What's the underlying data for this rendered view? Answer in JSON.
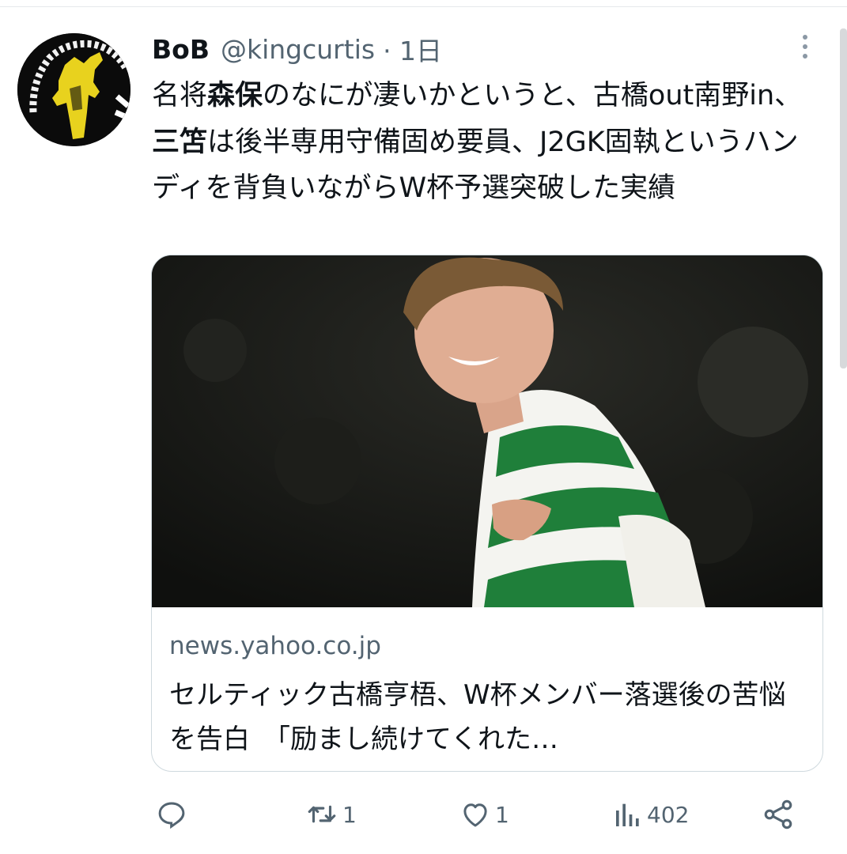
{
  "tweet": {
    "author_name": "BoB",
    "handle": "@kingcurtis",
    "time": "· 1日",
    "text_parts": [
      "名将",
      "森保",
      "のなにが凄いかというと、古橋out南野in、",
      "三笘",
      "は後半専用守備固め要員、J2GK固執というハンディを背負いながらW杯予選突破した実績"
    ],
    "avatar_icon": "band-album-avatar-icon",
    "more_icon": "more-options-icon"
  },
  "link_card": {
    "domain": "news.yahoo.co.jp",
    "title": "セルティック古橋亨梧、W杯メンバー落選後の苦悩を告白　「励まし続けてくれた…",
    "image": "celtic-player-photo"
  },
  "actions": {
    "reply": {
      "icon": "reply-icon",
      "count": ""
    },
    "retweet": {
      "icon": "retweet-icon",
      "count": "1"
    },
    "like": {
      "icon": "heart-icon",
      "count": "1"
    },
    "views": {
      "icon": "views-chart-icon",
      "count": "402"
    },
    "share": {
      "icon": "share-icon"
    }
  },
  "colors": {
    "text": "#0f1419",
    "secondary": "#536471",
    "border": "#cfd9de",
    "jersey_green": "#1f7f3a"
  }
}
